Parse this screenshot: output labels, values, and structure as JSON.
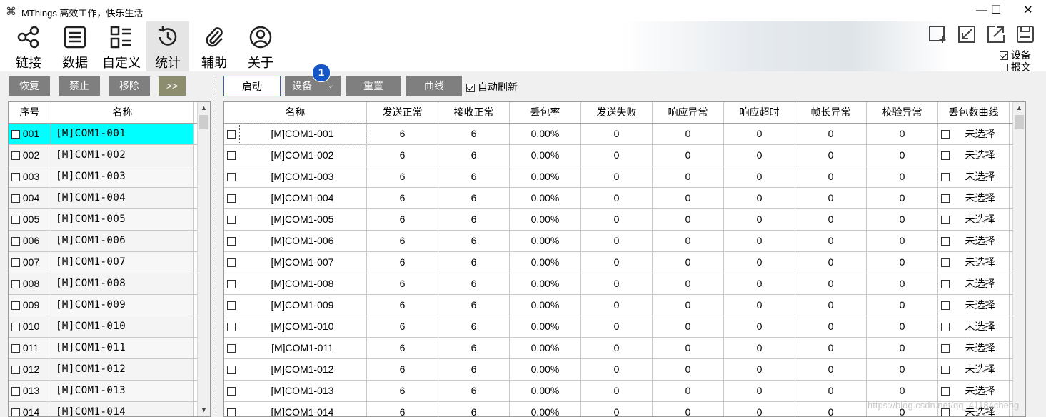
{
  "app": {
    "title": "MThings  高效工作，快乐生活",
    "icon": "app-logo-icon"
  },
  "window_controls": {
    "minimize": "—",
    "maximize": "☐",
    "close": "✕"
  },
  "toolbar": {
    "items": [
      {
        "label": "链接",
        "icon": "share-icon"
      },
      {
        "label": "数据",
        "icon": "list-doc-icon"
      },
      {
        "label": "自定义",
        "icon": "custom-grid-icon"
      },
      {
        "label": "统计",
        "icon": "history-clock-icon"
      },
      {
        "label": "辅助",
        "icon": "paperclip-icon"
      },
      {
        "label": "关于",
        "icon": "user-circle-icon"
      }
    ],
    "active": "统计",
    "right_icons": [
      "new-window-icon",
      "import-icon",
      "export-icon",
      "save-icon"
    ],
    "checks": [
      {
        "label": "设备",
        "checked": true
      },
      {
        "label": "报文",
        "checked": false
      }
    ]
  },
  "left_panel": {
    "buttons": [
      "恢复",
      "禁止",
      "移除",
      ">>"
    ],
    "headers": [
      "序号",
      "名称"
    ],
    "rows": [
      {
        "index": "001",
        "name": "[M]COM1-001"
      },
      {
        "index": "002",
        "name": "[M]COM1-002"
      },
      {
        "index": "003",
        "name": "[M]COM1-003"
      },
      {
        "index": "004",
        "name": "[M]COM1-004"
      },
      {
        "index": "005",
        "name": "[M]COM1-005"
      },
      {
        "index": "006",
        "name": "[M]COM1-006"
      },
      {
        "index": "007",
        "name": "[M]COM1-007"
      },
      {
        "index": "008",
        "name": "[M]COM1-008"
      },
      {
        "index": "009",
        "name": "[M]COM1-009"
      },
      {
        "index": "010",
        "name": "[M]COM1-010"
      },
      {
        "index": "011",
        "name": "[M]COM1-011"
      },
      {
        "index": "012",
        "name": "[M]COM1-012"
      },
      {
        "index": "013",
        "name": "[M]COM1-013"
      },
      {
        "index": "014",
        "name": "[M]COM1-014"
      }
    ],
    "selected_index": 0,
    "selected_color": "#00ffff"
  },
  "right_panel": {
    "buttons": {
      "start": "启动",
      "device": "设备",
      "reset": "重置",
      "curve": "曲线"
    },
    "badge": "1",
    "auto_refresh": {
      "label": "自动刷新",
      "checked": true
    },
    "headers": [
      "名称",
      "发送正常",
      "接收正常",
      "丢包率",
      "发送失败",
      "响应异常",
      "响应超时",
      "帧长异常",
      "校验异常",
      "丢包数曲线"
    ],
    "rows": [
      {
        "name": "[M]COM1-001",
        "send_ok": "6",
        "recv_ok": "6",
        "loss": "0.00%",
        "send_fail": "0",
        "resp_err": "0",
        "resp_timeout": "0",
        "len_err": "0",
        "crc_err": "0",
        "curve": "未选择"
      },
      {
        "name": "[M]COM1-002",
        "send_ok": "6",
        "recv_ok": "6",
        "loss": "0.00%",
        "send_fail": "0",
        "resp_err": "0",
        "resp_timeout": "0",
        "len_err": "0",
        "crc_err": "0",
        "curve": "未选择"
      },
      {
        "name": "[M]COM1-003",
        "send_ok": "6",
        "recv_ok": "6",
        "loss": "0.00%",
        "send_fail": "0",
        "resp_err": "0",
        "resp_timeout": "0",
        "len_err": "0",
        "crc_err": "0",
        "curve": "未选择"
      },
      {
        "name": "[M]COM1-004",
        "send_ok": "6",
        "recv_ok": "6",
        "loss": "0.00%",
        "send_fail": "0",
        "resp_err": "0",
        "resp_timeout": "0",
        "len_err": "0",
        "crc_err": "0",
        "curve": "未选择"
      },
      {
        "name": "[M]COM1-005",
        "send_ok": "6",
        "recv_ok": "6",
        "loss": "0.00%",
        "send_fail": "0",
        "resp_err": "0",
        "resp_timeout": "0",
        "len_err": "0",
        "crc_err": "0",
        "curve": "未选择"
      },
      {
        "name": "[M]COM1-006",
        "send_ok": "6",
        "recv_ok": "6",
        "loss": "0.00%",
        "send_fail": "0",
        "resp_err": "0",
        "resp_timeout": "0",
        "len_err": "0",
        "crc_err": "0",
        "curve": "未选择"
      },
      {
        "name": "[M]COM1-007",
        "send_ok": "6",
        "recv_ok": "6",
        "loss": "0.00%",
        "send_fail": "0",
        "resp_err": "0",
        "resp_timeout": "0",
        "len_err": "0",
        "crc_err": "0",
        "curve": "未选择"
      },
      {
        "name": "[M]COM1-008",
        "send_ok": "6",
        "recv_ok": "6",
        "loss": "0.00%",
        "send_fail": "0",
        "resp_err": "0",
        "resp_timeout": "0",
        "len_err": "0",
        "crc_err": "0",
        "curve": "未选择"
      },
      {
        "name": "[M]COM1-009",
        "send_ok": "6",
        "recv_ok": "6",
        "loss": "0.00%",
        "send_fail": "0",
        "resp_err": "0",
        "resp_timeout": "0",
        "len_err": "0",
        "crc_err": "0",
        "curve": "未选择"
      },
      {
        "name": "[M]COM1-010",
        "send_ok": "6",
        "recv_ok": "6",
        "loss": "0.00%",
        "send_fail": "0",
        "resp_err": "0",
        "resp_timeout": "0",
        "len_err": "0",
        "crc_err": "0",
        "curve": "未选择"
      },
      {
        "name": "[M]COM1-011",
        "send_ok": "6",
        "recv_ok": "6",
        "loss": "0.00%",
        "send_fail": "0",
        "resp_err": "0",
        "resp_timeout": "0",
        "len_err": "0",
        "crc_err": "0",
        "curve": "未选择"
      },
      {
        "name": "[M]COM1-012",
        "send_ok": "6",
        "recv_ok": "6",
        "loss": "0.00%",
        "send_fail": "0",
        "resp_err": "0",
        "resp_timeout": "0",
        "len_err": "0",
        "crc_err": "0",
        "curve": "未选择"
      },
      {
        "name": "[M]COM1-013",
        "send_ok": "6",
        "recv_ok": "6",
        "loss": "0.00%",
        "send_fail": "0",
        "resp_err": "0",
        "resp_timeout": "0",
        "len_err": "0",
        "crc_err": "0",
        "curve": "未选择"
      },
      {
        "name": "[M]COM1-014",
        "send_ok": "6",
        "recv_ok": "6",
        "loss": "0.00%",
        "send_fail": "0",
        "resp_err": "0",
        "resp_timeout": "0",
        "len_err": "0",
        "crc_err": "0",
        "curve": "未选择"
      }
    ]
  },
  "watermark": "https://blog.csdn.net/qq_41184cheng"
}
